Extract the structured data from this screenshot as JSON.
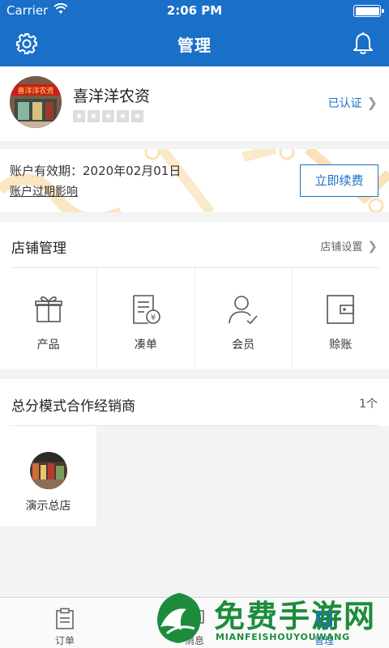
{
  "status_bar": {
    "carrier": "Carrier",
    "time": "2:06 PM"
  },
  "nav": {
    "title": "管理"
  },
  "profile": {
    "shop_name": "喜洋洋农资",
    "verified": "已认证",
    "rating_stars": 0,
    "rating_max": 5
  },
  "account": {
    "validity": "账户有效期：2020年02月01日",
    "expire_link": "账户过期影响",
    "renew_button": "立即续费"
  },
  "store": {
    "title": "店铺管理",
    "settings_label": "店铺设置",
    "items": [
      {
        "label": "产品",
        "icon": "gift-icon"
      },
      {
        "label": "凑单",
        "icon": "bill-yuan-icon"
      },
      {
        "label": "会员",
        "icon": "member-icon"
      },
      {
        "label": "赊账",
        "icon": "wallet-icon"
      }
    ]
  },
  "distributors": {
    "title": "总分模式合作经销商",
    "count": "1个",
    "items": [
      {
        "name": "演示总店"
      }
    ]
  },
  "tabbar": {
    "tabs": [
      {
        "label": "订单",
        "icon": "clipboard-icon",
        "active": false
      },
      {
        "label": "消息",
        "icon": "chat-icon",
        "active": false
      },
      {
        "label": "管理",
        "icon": "manage-icon",
        "active": true
      }
    ]
  },
  "watermark": {
    "title": "免费手游网",
    "subtitle": "MIANFEISHOUYOUWANG"
  },
  "colors": {
    "primary": "#1a6fc9",
    "background": "#f3f3f3",
    "watermark": "#1c8c3c"
  }
}
